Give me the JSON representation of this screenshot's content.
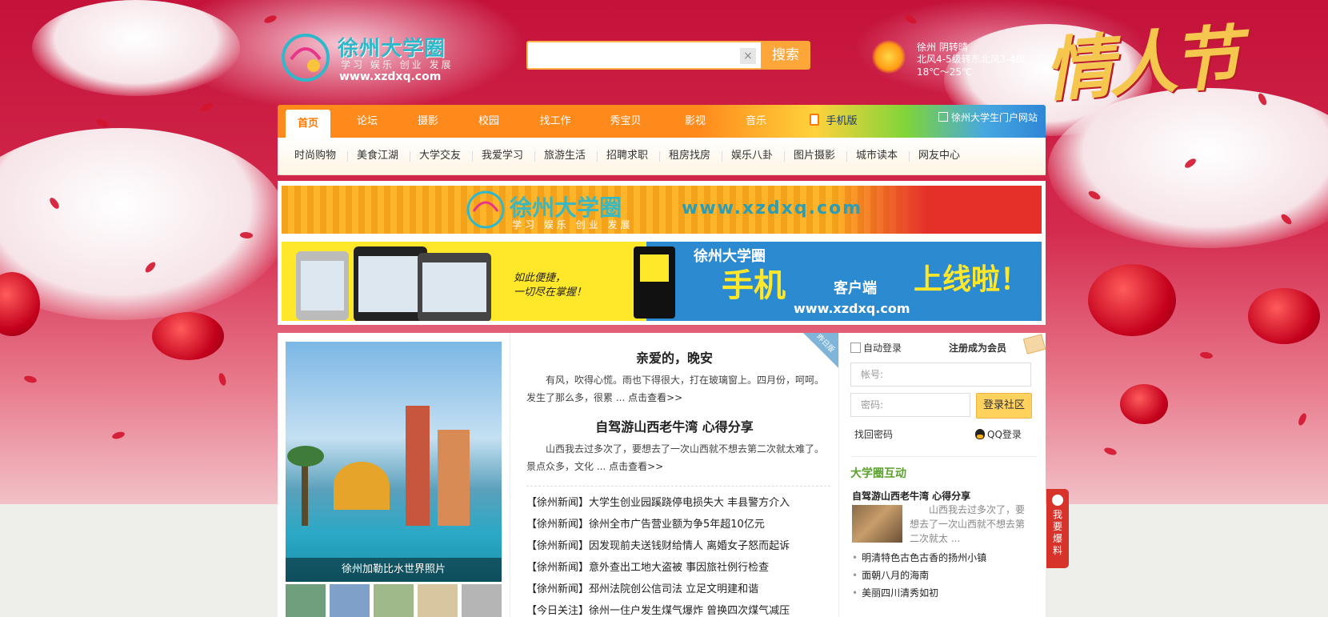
{
  "header": {
    "logo": {
      "title": "徐州大学圈",
      "tagline": "学习 娱乐 创业 发展",
      "url": "www.xzdxq.com"
    },
    "search": {
      "value": "",
      "clear_icon": "×",
      "button_label": "搜索"
    },
    "weather": {
      "icon": "sun-icon",
      "city_condition": "徐州 阴转晴",
      "wind": "北风4-5级转东北风3-4级",
      "temperature": "18℃～25℃"
    },
    "festival_art": "情人节"
  },
  "nav": {
    "items": [
      {
        "label": "首页",
        "active": true
      },
      {
        "label": "论坛"
      },
      {
        "label": "摄影"
      },
      {
        "label": "校园"
      },
      {
        "label": "找工作"
      },
      {
        "label": "秀宝贝"
      },
      {
        "label": "影视"
      },
      {
        "label": "音乐"
      },
      {
        "label": "手机版"
      }
    ],
    "portal": "徐州大学生门户网站"
  },
  "subnav": {
    "items": [
      "时尚购物",
      "美食江湖",
      "大学交友",
      "我爱学习",
      "旅游生活",
      "招聘求职",
      "租房找房",
      "娱乐八卦",
      "图片摄影",
      "城市读本",
      "网友中心"
    ]
  },
  "banners": {
    "banner1": {
      "title": "徐州大学圈",
      "tagline": "学习 娱乐 创业 发展",
      "url": "www.xzdxq.com"
    },
    "banner2": {
      "slogan_line1": "如此便捷，",
      "slogan_line2": "一切尽在掌握！",
      "brand": "徐州大学圈",
      "title_big": "手机",
      "title_mid": "客户端",
      "title_end": "上线啦！",
      "url": "www.xzdxq.com"
    }
  },
  "photo": {
    "caption": "徐州加勒比水世界照片"
  },
  "articles": [
    {
      "title": "亲爱的，晚安",
      "body": "有风，吹得心慌。雨也下得很大，打在玻璃窗上。四月份，呵呵。发生了那么多，很累 ...",
      "more_link": "点击查看>>"
    },
    {
      "title": "自驾游山西老牛湾 心得分享",
      "body": "山西我去过多次了，要想去了一次山西就不想去第二次就太难了。景点众多，文化 ...",
      "more_link": "点击查看>>"
    }
  ],
  "corner_tag": "昨日版",
  "news": [
    "【徐州新闻】大学生创业园蹊跷停电损失大 丰县警方介入",
    "【徐州新闻】徐州全市广告营业额为争5年超10亿元",
    "【徐州新闻】因发现前夫送钱财给情人 离婚女子怒而起诉",
    "【徐州新闻】意外查出工地大盗被 事因旅社例行检查",
    "【徐州新闻】邳州法院创公信司法 立足文明建和谐",
    "【今日关注】徐州一住户发生煤气爆炸 曾换四次煤气减压"
  ],
  "login": {
    "auto_login": "自动登录",
    "register": "注册成为会员",
    "account_placeholder": "帐号:",
    "password_placeholder": "密码:",
    "login_button": "登录社区",
    "forgot_password": "找回密码",
    "qq_login": "QQ登录"
  },
  "interact": {
    "section_title": "大学圈互动",
    "featured_title": "自驾游山西老牛湾 心得分享",
    "featured_body": "山西我去过多次了，要想去了一次山西就不想去第二次就太 ...",
    "list": [
      "明清特色古色古香的扬州小镇",
      "面朝八月的海南",
      "美丽四川清秀如初"
    ]
  },
  "side_tab": {
    "label": "我要爆料"
  },
  "colors": {
    "nav_orange": "#ff8a1c",
    "accent_red": "#d7332a",
    "link_green": "#5ba12d"
  }
}
